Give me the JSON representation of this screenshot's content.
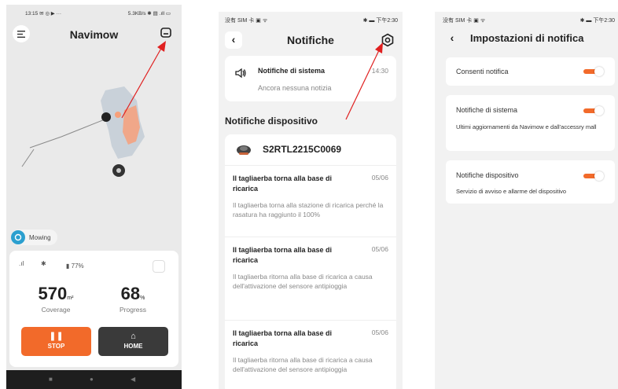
{
  "colors": {
    "accent": "#f26a2a",
    "annotation": "#e02020",
    "home_button": "#3a3a3a"
  },
  "screen1": {
    "status_left": "13:15 ✉ ◎ ▶ ···",
    "status_right": "5.3KB/s ✱ ▤ .ıll ▭",
    "title": "Navimow",
    "mode_badge": "Mowing",
    "battery": "77%",
    "coverage_value": "570",
    "coverage_unit": "m²",
    "coverage_label": "Coverage",
    "progress_value": "68",
    "progress_unit": "%",
    "progress_label": "Progress",
    "stop_label": "STOP",
    "home_label": "HOME"
  },
  "screen2": {
    "status_left": "没有 SIM 卡 ▣ ᯤ",
    "status_right": "✱ ▬ 下午2:30",
    "title": "Notifiche",
    "system": {
      "title": "Notifiche di sistema",
      "time": "14:30",
      "subtitle": "Ancora nessuna notizia"
    },
    "device_section": "Notifiche dispositivo",
    "device_id": "S2RTL2215C0069",
    "notifications": [
      {
        "title": "Il tagliaerba torna alla base di ricarica",
        "date": "05/06",
        "body": "Il tagliaerba torna alla stazione di ricarica perché la rasatura ha raggiunto il 100%"
      },
      {
        "title": "Il tagliaerba torna alla base di ricarica",
        "date": "05/06",
        "body": "Il tagliaerba ritorna alla base di ricarica a causa dell'attivazione del sensore antipioggia"
      },
      {
        "title": "Il tagliaerba torna alla base di ricarica",
        "date": "05/06",
        "body": "Il tagliaerba ritorna alla base di ricarica a causa dell'attivazione del sensore antipioggia"
      }
    ]
  },
  "screen3": {
    "status_left": "没有 SIM 卡 ▣ ᯤ",
    "status_right": "✱ ▬ 下午2:30",
    "title": "Impostazioni di notifica",
    "options": [
      {
        "title": "Consenti notifica",
        "desc": "",
        "enabled": true
      },
      {
        "title": "Notifiche di sistema",
        "desc": "Ultimi aggiornamenti da Navimow e dall'accessry mall",
        "enabled": true
      },
      {
        "title": "Notifiche dispositivo",
        "desc": "Servizio di avviso e allarme del dispositivo",
        "enabled": true
      }
    ]
  }
}
